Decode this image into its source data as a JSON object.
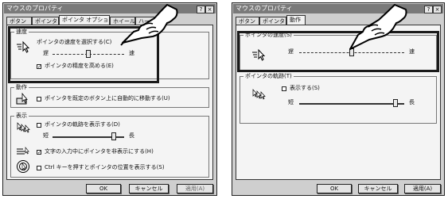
{
  "left": {
    "title": "マウスのプロパティ",
    "tabs": [
      "ボタン",
      "ポインタ",
      "ポインタ オプション",
      "ホイール",
      "ハードウェア"
    ],
    "speed": {
      "group": "速度",
      "label": "ポインタの速度を選択する(C)",
      "slow": "遅",
      "fast": "速",
      "value": 0.5,
      "precision": "ポインタの精度を高める(E)",
      "precision_checked": true
    },
    "snap": {
      "group": "動作",
      "label": "ポインタを既定のボタン上に自動的に移動する(U)",
      "checked": false
    },
    "visibility": {
      "group": "表示",
      "trail": "ポインタの軌跡を表示する(D)",
      "trail_checked": false,
      "short": "短",
      "long": "長",
      "trail_value": 0.85,
      "hide": "文字の入力中にポインタを非表示にする(H)",
      "hide_checked": true,
      "ctrl": "Ctrl キーを押すとポインタの位置を表示する(S)",
      "ctrl_checked": false
    },
    "buttons": {
      "ok": "OK",
      "cancel": "キャンセル",
      "apply": "適用(A)"
    }
  },
  "right": {
    "title": "マウスのプロパティ",
    "tabs": [
      "ボタン",
      "ポインタ",
      "動作"
    ],
    "speed": {
      "group": "ポインタの速度(S)",
      "slow": "遅",
      "fast": "速",
      "value": 0.5
    },
    "trail": {
      "group": "ポインタの軌跡(T)",
      "label": "表示する(S)",
      "checked": false,
      "short": "短",
      "long": "長",
      "value": 0.92
    },
    "buttons": {
      "ok": "OK",
      "cancel": "キャンセル",
      "apply": "適用(A)"
    }
  },
  "icons": [
    "hand-pointer-icon",
    "pointer-speed-icon",
    "snap-to-icon",
    "pointer-trail-icon",
    "hide-pointer-icon",
    "ctrl-locate-icon",
    "help-icon",
    "close-icon"
  ]
}
